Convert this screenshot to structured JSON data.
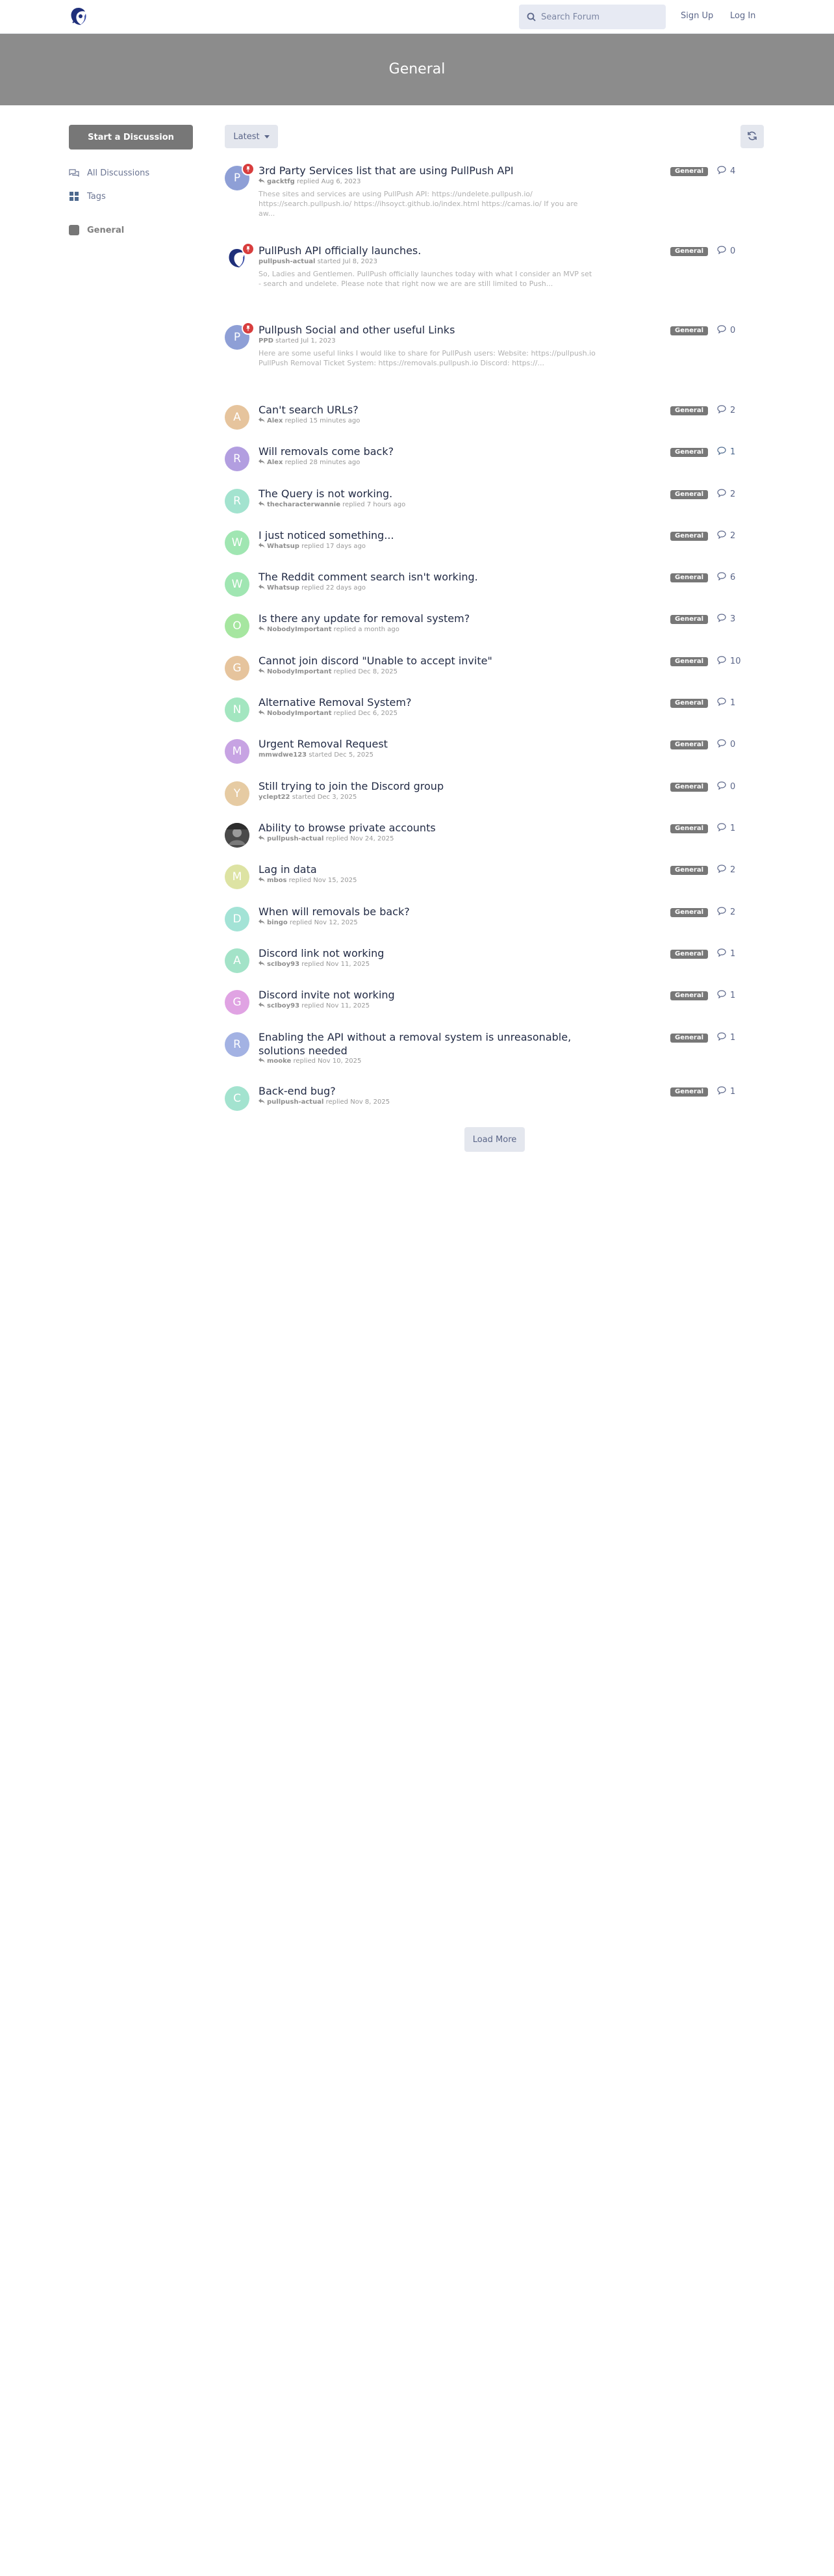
{
  "header": {
    "search_placeholder": "Search Forum",
    "sign_up": "Sign Up",
    "log_in": "Log In"
  },
  "hero": {
    "title": "General"
  },
  "sidebar": {
    "start_button": "Start a Discussion",
    "items": [
      {
        "label": "All Discussions",
        "icon": "comments-icon"
      },
      {
        "label": "Tags",
        "icon": "tags-grid-icon"
      },
      {
        "label": "General",
        "icon": "tag-square-icon",
        "color": "#777777"
      }
    ]
  },
  "toolbar": {
    "sort_label": "Latest",
    "refresh_icon": "refresh-icon"
  },
  "colors": {
    "tag": "#777777",
    "pin": "#d83e3e",
    "hero": "#8c8c8c"
  },
  "discussions": [
    {
      "title": "3rd Party Services list that are using PullPush API",
      "user": "gacktfg",
      "action": "replied",
      "time": "Aug 6, 2023",
      "reply_icon": true,
      "pinned": true,
      "avatar_letter": "P",
      "avatar_color": "#8e9fd6",
      "excerpt": "These sites and services are using PullPush API: https://undelete.pullpush.io/ https://search.pullpush.io/ https://ihsoyct.github.io/index.html https://camas.io/ If you are aw...",
      "tag": "General",
      "count": "4",
      "unread": false
    },
    {
      "title": "PullPush API officially launches.",
      "user": "pullpush-actual",
      "action": "started",
      "time": "Jul 8, 2023",
      "reply_icon": false,
      "pinned": true,
      "avatar_letter": "",
      "avatar_color": "#ffffff",
      "avatar_image": "logo",
      "excerpt": "So, Ladies and Gentlemen. PullPush officially launches today with what I consider an MVP set - search and undelete. Please note that right now we are are still limited to Push...",
      "tag": "General",
      "count": "0",
      "unread": false
    },
    {
      "title": "Pullpush Social and other useful Links",
      "user": "PPD",
      "action": "started",
      "time": "Jul 1, 2023",
      "reply_icon": false,
      "pinned": true,
      "avatar_letter": "P",
      "avatar_color": "#8e9fd6",
      "excerpt": "Here are some useful links I would like to share for PullPush users: Website: https://pullpush.io PullPush Removal Ticket System: https://removals.pullpush.io Discord: https://...",
      "tag": "General",
      "count": "0",
      "unread": false
    },
    {
      "title": "Can't search URLs?",
      "user": "Alex",
      "action": "replied",
      "time": "15 minutes ago",
      "reply_icon": true,
      "pinned": false,
      "avatar_letter": "A",
      "avatar_color": "#e6c49d",
      "tag": "General",
      "count": "2",
      "unread": false
    },
    {
      "title": "Will removals come back?",
      "user": "Alex",
      "action": "replied",
      "time": "28 minutes ago",
      "reply_icon": true,
      "pinned": false,
      "avatar_letter": "R",
      "avatar_color": "#b29ee0",
      "tag": "General",
      "count": "1",
      "unread": true
    },
    {
      "title": "The Query is not working.",
      "user": "thecharacterwannie",
      "action": "replied",
      "time": "7 hours ago",
      "reply_icon": true,
      "pinned": false,
      "avatar_letter": "R",
      "avatar_color": "#a3e3cf",
      "tag": "General",
      "count": "2",
      "unread": false
    },
    {
      "title": "I just noticed something...",
      "user": "Whatsup",
      "action": "replied",
      "time": "17 days ago",
      "reply_icon": true,
      "pinned": false,
      "avatar_letter": "W",
      "avatar_color": "#a0e6b2",
      "tag": "General",
      "count": "2",
      "unread": false
    },
    {
      "title": "The Reddit comment search isn't working.",
      "user": "Whatsup",
      "action": "replied",
      "time": "22 days ago",
      "reply_icon": true,
      "pinned": false,
      "avatar_letter": "W",
      "avatar_color": "#a0e6b2",
      "tag": "General",
      "count": "6",
      "unread": false
    },
    {
      "title": "Is there any update for removal system?",
      "user": "NobodyImportant",
      "action": "replied",
      "time": "a month ago",
      "reply_icon": true,
      "pinned": false,
      "avatar_letter": "O",
      "avatar_color": "#a6e6a0",
      "tag": "General",
      "count": "3",
      "unread": false
    },
    {
      "title": "Cannot join discord \"Unable to accept invite\"",
      "user": "NobodyImportant",
      "action": "replied",
      "time": "Dec 8, 2025",
      "reply_icon": true,
      "pinned": false,
      "avatar_letter": "G",
      "avatar_color": "#e6c49d",
      "tag": "General",
      "count": "10",
      "unread": false
    },
    {
      "title": "Alternative Removal System?",
      "user": "NobodyImportant",
      "action": "replied",
      "time": "Dec 6, 2025",
      "reply_icon": true,
      "pinned": false,
      "avatar_letter": "N",
      "avatar_color": "#a3e6c0",
      "tag": "General",
      "count": "1",
      "unread": false
    },
    {
      "title": "Urgent Removal Request",
      "user": "mmwdwe123",
      "action": "started",
      "time": "Dec 5, 2025",
      "reply_icon": false,
      "pinned": false,
      "avatar_letter": "M",
      "avatar_color": "#c7a3e3",
      "tag": "General",
      "count": "0",
      "unread": false
    },
    {
      "title": "Still trying to join the Discord group",
      "user": "yclept22",
      "action": "started",
      "time": "Dec 3, 2025",
      "reply_icon": false,
      "pinned": false,
      "avatar_letter": "Y",
      "avatar_color": "#e6cba3",
      "tag": "General",
      "count": "0",
      "unread": false
    },
    {
      "title": "Ability to browse private accounts",
      "user": "pullpush-actual",
      "action": "replied",
      "time": "Nov 24, 2025",
      "reply_icon": true,
      "pinned": false,
      "avatar_letter": "",
      "avatar_color": "#555555",
      "avatar_image": "photo",
      "tag": "General",
      "count": "1",
      "unread": false
    },
    {
      "title": "Lag in data",
      "user": "mbos",
      "action": "replied",
      "time": "Nov 15, 2025",
      "reply_icon": true,
      "pinned": false,
      "avatar_letter": "M",
      "avatar_color": "#dde3a3",
      "tag": "General",
      "count": "2",
      "unread": false
    },
    {
      "title": "When will removals be back?",
      "user": "bingo",
      "action": "replied",
      "time": "Nov 12, 2025",
      "reply_icon": true,
      "pinned": false,
      "avatar_letter": "D",
      "avatar_color": "#a3e3d6",
      "tag": "General",
      "count": "2",
      "unread": false
    },
    {
      "title": "Discord link not working",
      "user": "scIboy93",
      "action": "replied",
      "time": "Nov 11, 2025",
      "reply_icon": true,
      "pinned": false,
      "avatar_letter": "A",
      "avatar_color": "#a3e3c8",
      "tag": "General",
      "count": "1",
      "unread": false
    },
    {
      "title": "Discord invite not working",
      "user": "scIboy93",
      "action": "replied",
      "time": "Nov 11, 2025",
      "reply_icon": true,
      "pinned": false,
      "avatar_letter": "G",
      "avatar_color": "#e0a3e3",
      "tag": "General",
      "count": "1",
      "unread": false
    },
    {
      "title": "Enabling the API without a removal system is unreasonable, solutions needed",
      "user": "mooke",
      "action": "replied",
      "time": "Nov 10, 2025",
      "reply_icon": true,
      "pinned": false,
      "avatar_letter": "R",
      "avatar_color": "#a3b2e3",
      "tag": "General",
      "count": "1",
      "unread": false
    },
    {
      "title": "Back-end bug?",
      "user": "pullpush-actual",
      "action": "replied",
      "time": "Nov 8, 2025",
      "reply_icon": true,
      "pinned": false,
      "avatar_letter": "C",
      "avatar_color": "#a3e3cf",
      "tag": "General",
      "count": "1",
      "unread": false
    }
  ],
  "load_more": "Load More"
}
